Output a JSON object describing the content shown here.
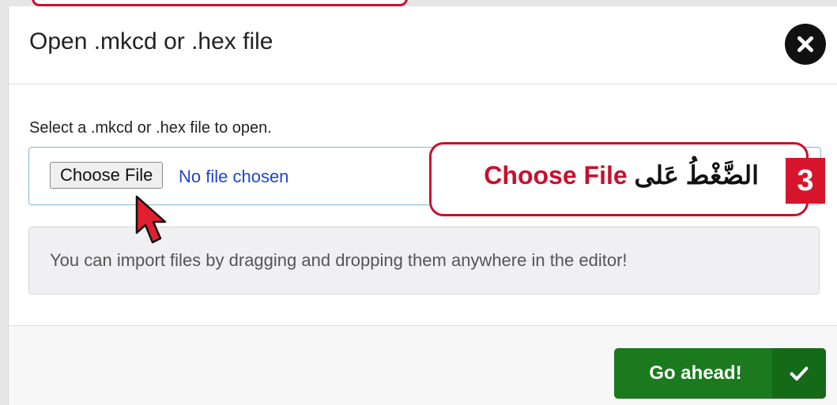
{
  "dialog": {
    "title": "Open .mkcd or .hex file",
    "close_icon": "close-icon",
    "prompt": "Select a .mkcd or .hex file to open.",
    "file_input": {
      "button_label": "Choose File",
      "status": "No file chosen"
    },
    "info": "You can import files by dragging and dropping them anywhere in the editor!",
    "confirm_button": {
      "label": "Go ahead!",
      "icon": "checkmark-icon"
    }
  },
  "annotation": {
    "step": "3",
    "text_red": "Choose File",
    "text_black": "الضَّغْطُ عَلى",
    "color": "#c8102e"
  },
  "colors": {
    "confirm": "#1a7a1d",
    "annotation_red": "#c8102e",
    "link_blue": "#2244cc"
  }
}
